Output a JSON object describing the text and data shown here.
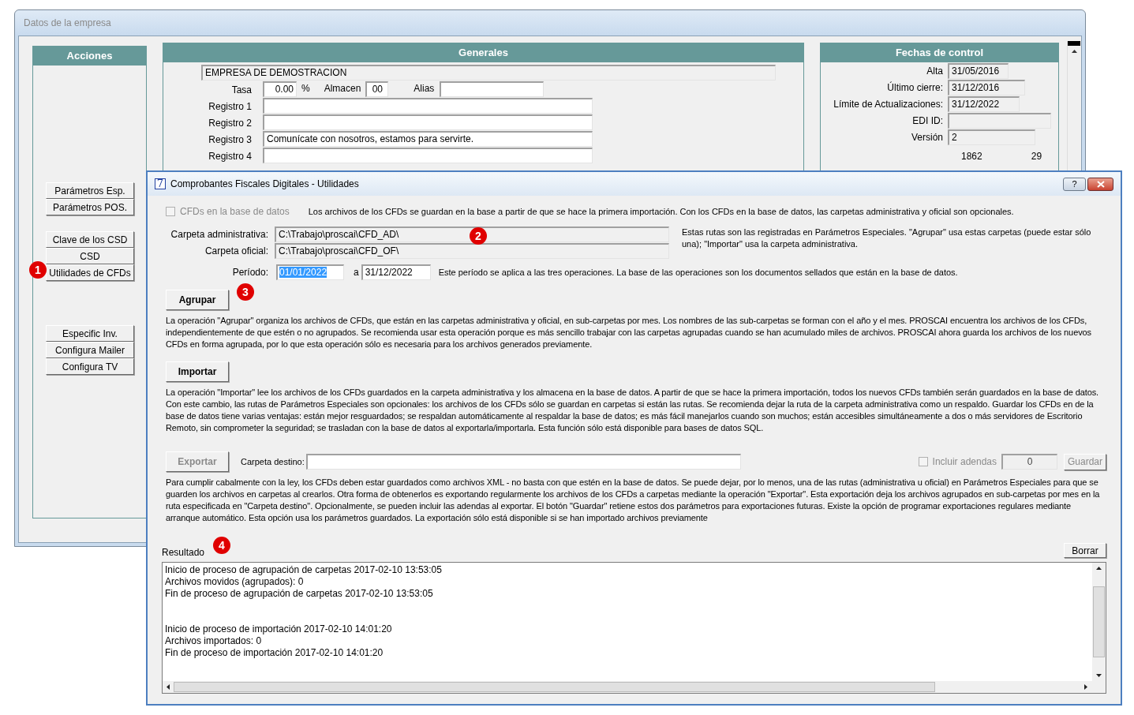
{
  "main_window": {
    "title": "Datos de la empresa"
  },
  "acciones": {
    "title": "Acciones",
    "button_groups": [
      [
        {
          "label": "Parámetros Esp."
        },
        {
          "label": "Parámetros POS."
        }
      ],
      [
        {
          "label": "Clave de los CSD"
        },
        {
          "label": "CSD"
        },
        {
          "label": "Utilidades de CFDs"
        }
      ],
      [
        {
          "label": "Especific Inv."
        },
        {
          "label": "Configura Mailer"
        },
        {
          "label": "Configura TV"
        }
      ]
    ]
  },
  "generales": {
    "title": "Generales",
    "company_name": "EMPRESA DE DEMOSTRACION",
    "tasa": {
      "label": "Tasa",
      "value": "0.00"
    },
    "percent": "%",
    "almacen": {
      "label": "Almacen",
      "value": "00"
    },
    "alias": {
      "label": "Alias"
    },
    "registros": [
      {
        "label": "Registro 1"
      },
      {
        "label": "Registro 2"
      },
      {
        "label": "Registro 3",
        "value": "Comunícate con nosotros, estamos para servirte."
      },
      {
        "label": "Registro 4"
      }
    ]
  },
  "fechas": {
    "title": "Fechas de control",
    "fields": [
      {
        "label": "Alta",
        "value": "31/05/2016"
      },
      {
        "label": "Último cierre:",
        "value": "31/12/2016"
      },
      {
        "label": "Límite de Actualizaciones:",
        "value": "31/12/2022"
      },
      {
        "label": "EDI ID:"
      },
      {
        "label": "Versión",
        "value": "2"
      }
    ],
    "counters": [
      "1862",
      "29"
    ]
  },
  "dialog": {
    "icon_glyph": "7",
    "title": "Comprobantes Fiscales Digitales - Utilidades",
    "help_button": "?",
    "store_checkbox": {
      "label": "CFDs en la base de datos",
      "checked": false,
      "disabled": true
    },
    "store_note": "Los archivos de los CFDs se guardan en la base a partir de que se hace la primera importación. Con los CFDs en la base de datos, las carpetas administrativa y oficial son opcionales.",
    "paths": [
      {
        "label": "Carpeta administrativa:",
        "value": "C:\\Trabajo\\proscai\\CFD_AD\\"
      },
      {
        "label": "Carpeta oficial:",
        "value": "C:\\Trabajo\\proscai\\CFD_OF\\"
      }
    ],
    "paths_note": "Estas rutas son las registradas en Parámetros Especiales. \"Agrupar\" usa estas carpetas (puede estar sólo una); \"Importar\" usa la carpeta administrativa.",
    "period": {
      "label": "Período:",
      "from": "01/01/2022",
      "from_selected": true,
      "separator": "a",
      "to": "31/12/2022",
      "note": "Este período se aplica a las tres operaciones. La base de las operaciones son los documentos sellados que están en la base de datos."
    },
    "operations": [
      {
        "kind": "plain",
        "button": "Agrupar",
        "disabled": false,
        "description": "La operación \"Agrupar\" organiza los archivos de CFDs, que están en las carpetas administrativa y oficial, en sub-carpetas por mes. Los nombres de las sub-carpetas se forman con el año y el mes. PROSCAI encuentra los archivos de los CFDs, independientemente de que estén o no agrupados. Se recomienda usar esta operación porque es más sencillo trabajar con las carpetas agrupadas cuando se han acumulado miles de archivos. PROSCAI ahora guarda los archivos de los nuevos CFDs en forma agrupada, por lo que esta operación sólo es necesaria para los archivos generados previamente."
      },
      {
        "kind": "plain",
        "button": "Importar",
        "disabled": false,
        "description": "La operación \"Importar\" lee los archivos de los CFDs guardados en la carpeta administrativa y los almacena en la base de datos. A partir de que se hace la primera importación, todos los nuevos CFDs también serán guardados en la base de datos. Con este cambio, las rutas de Parámetros Especiales son opcionales: los archivos de los CFDs sólo se guardan en carpetas si están las rutas. Se recomienda dejar la ruta de la carpeta administrativa como un respaldo. Guardar los CFDs en de la base de datos tiene varias ventajas: están mejor resguardados; se respaldan automáticamente al respaldar la base de datos; es más fácil manejarlos cuando son muchos; están accesibles simultáneamente a dos o más servidores de Escritorio Remoto, sin comprometer la seguridad; se trasladan con la base de datos al exportarla/importarla. Esta función sólo está disponible para bases de datos SQL."
      },
      {
        "kind": "export",
        "button": "Exportar",
        "disabled": true,
        "destination_label": "Carpeta destino:",
        "addenda_checkbox": {
          "label": "Incluir adendas",
          "checked": false,
          "disabled": true
        },
        "count": "0",
        "save_button": {
          "label": "Guardar",
          "disabled": true
        },
        "description": "Para cumplir cabalmente con la ley, los CFDs deben estar guardados como archivos XML - no basta con que estén en la base de datos. Se puede dejar, por lo menos, una de las rutas (administrativa u oficial) en Parámetros Especiales para que se guarden los archivos en carpetas al crearlos. Otra forma de obtenerlos es exportando regularmente los archivos de los CFDs a carpetas mediante la operación \"Exportar\". Esta exportación deja los archivos agrupados en sub-carpetas por mes en la ruta especificada en \"Carpeta destino\". Opcionalmente, se pueden incluir las adendas al exportar. El botón \"Guardar\" retiene estos dos parámetros para exportaciones futuras. Existe la opción de programar exportaciones regulares mediante arranque automático. Esta opción usa los parámetros guardados. La exportación sólo está disponible si se han importado archivos previamente"
      }
    ],
    "result": {
      "label": "Resultado",
      "clear_button": "Borrar",
      "log_groups": [
        [
          "Inicio de proceso de agrupación de carpetas 2017-02-10 13:53:05",
          "Archivos movidos (agrupados): 0",
          "Fin de proceso de agrupación de carpetas 2017-02-10 13:53:05"
        ],
        [
          "Inicio de proceso de importación 2017-02-10 14:01:20",
          "Archivos importados: 0",
          "Fin de proceso de importación 2017-02-10 14:01:20"
        ]
      ]
    }
  },
  "markers": [
    {
      "text": "1"
    },
    {
      "text": "2"
    },
    {
      "text": "3"
    },
    {
      "text": "4"
    }
  ]
}
